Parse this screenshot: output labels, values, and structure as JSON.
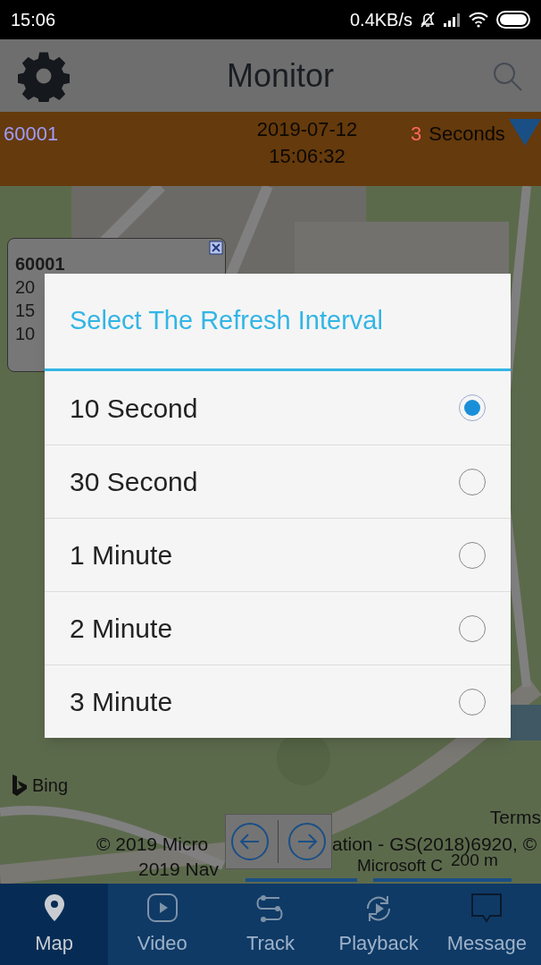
{
  "status_bar": {
    "time": "15:06",
    "speed": "0.4KB/s"
  },
  "header": {
    "title": "Monitor"
  },
  "info_bar": {
    "device": "60001",
    "date": "2019-07-12",
    "time": "15:06:32",
    "count": "3",
    "unit": "Seconds"
  },
  "vehicle_popup": {
    "lines": [
      "60001",
      "20",
      "15",
      "10"
    ]
  },
  "map": {
    "logo_text": "Bing",
    "terms": "Terms",
    "attribution": [
      "© 2019 Micro",
      "ation - GS(2018)6920, ©",
      "2019 Nav",
      "Microsoft C"
    ],
    "scale": "200 m"
  },
  "dialog": {
    "title": "Select The Refresh Interval",
    "options": [
      {
        "label": "10 Second",
        "selected": true
      },
      {
        "label": "30 Second",
        "selected": false
      },
      {
        "label": "1 Minute",
        "selected": false
      },
      {
        "label": "2 Minute",
        "selected": false
      },
      {
        "label": "3 Minute",
        "selected": false
      }
    ]
  },
  "tabs": [
    {
      "label": "Map",
      "selected": true
    },
    {
      "label": "Video",
      "selected": false
    },
    {
      "label": "Track",
      "selected": false
    },
    {
      "label": "Playback",
      "selected": false
    },
    {
      "label": "Message",
      "selected": false
    }
  ]
}
